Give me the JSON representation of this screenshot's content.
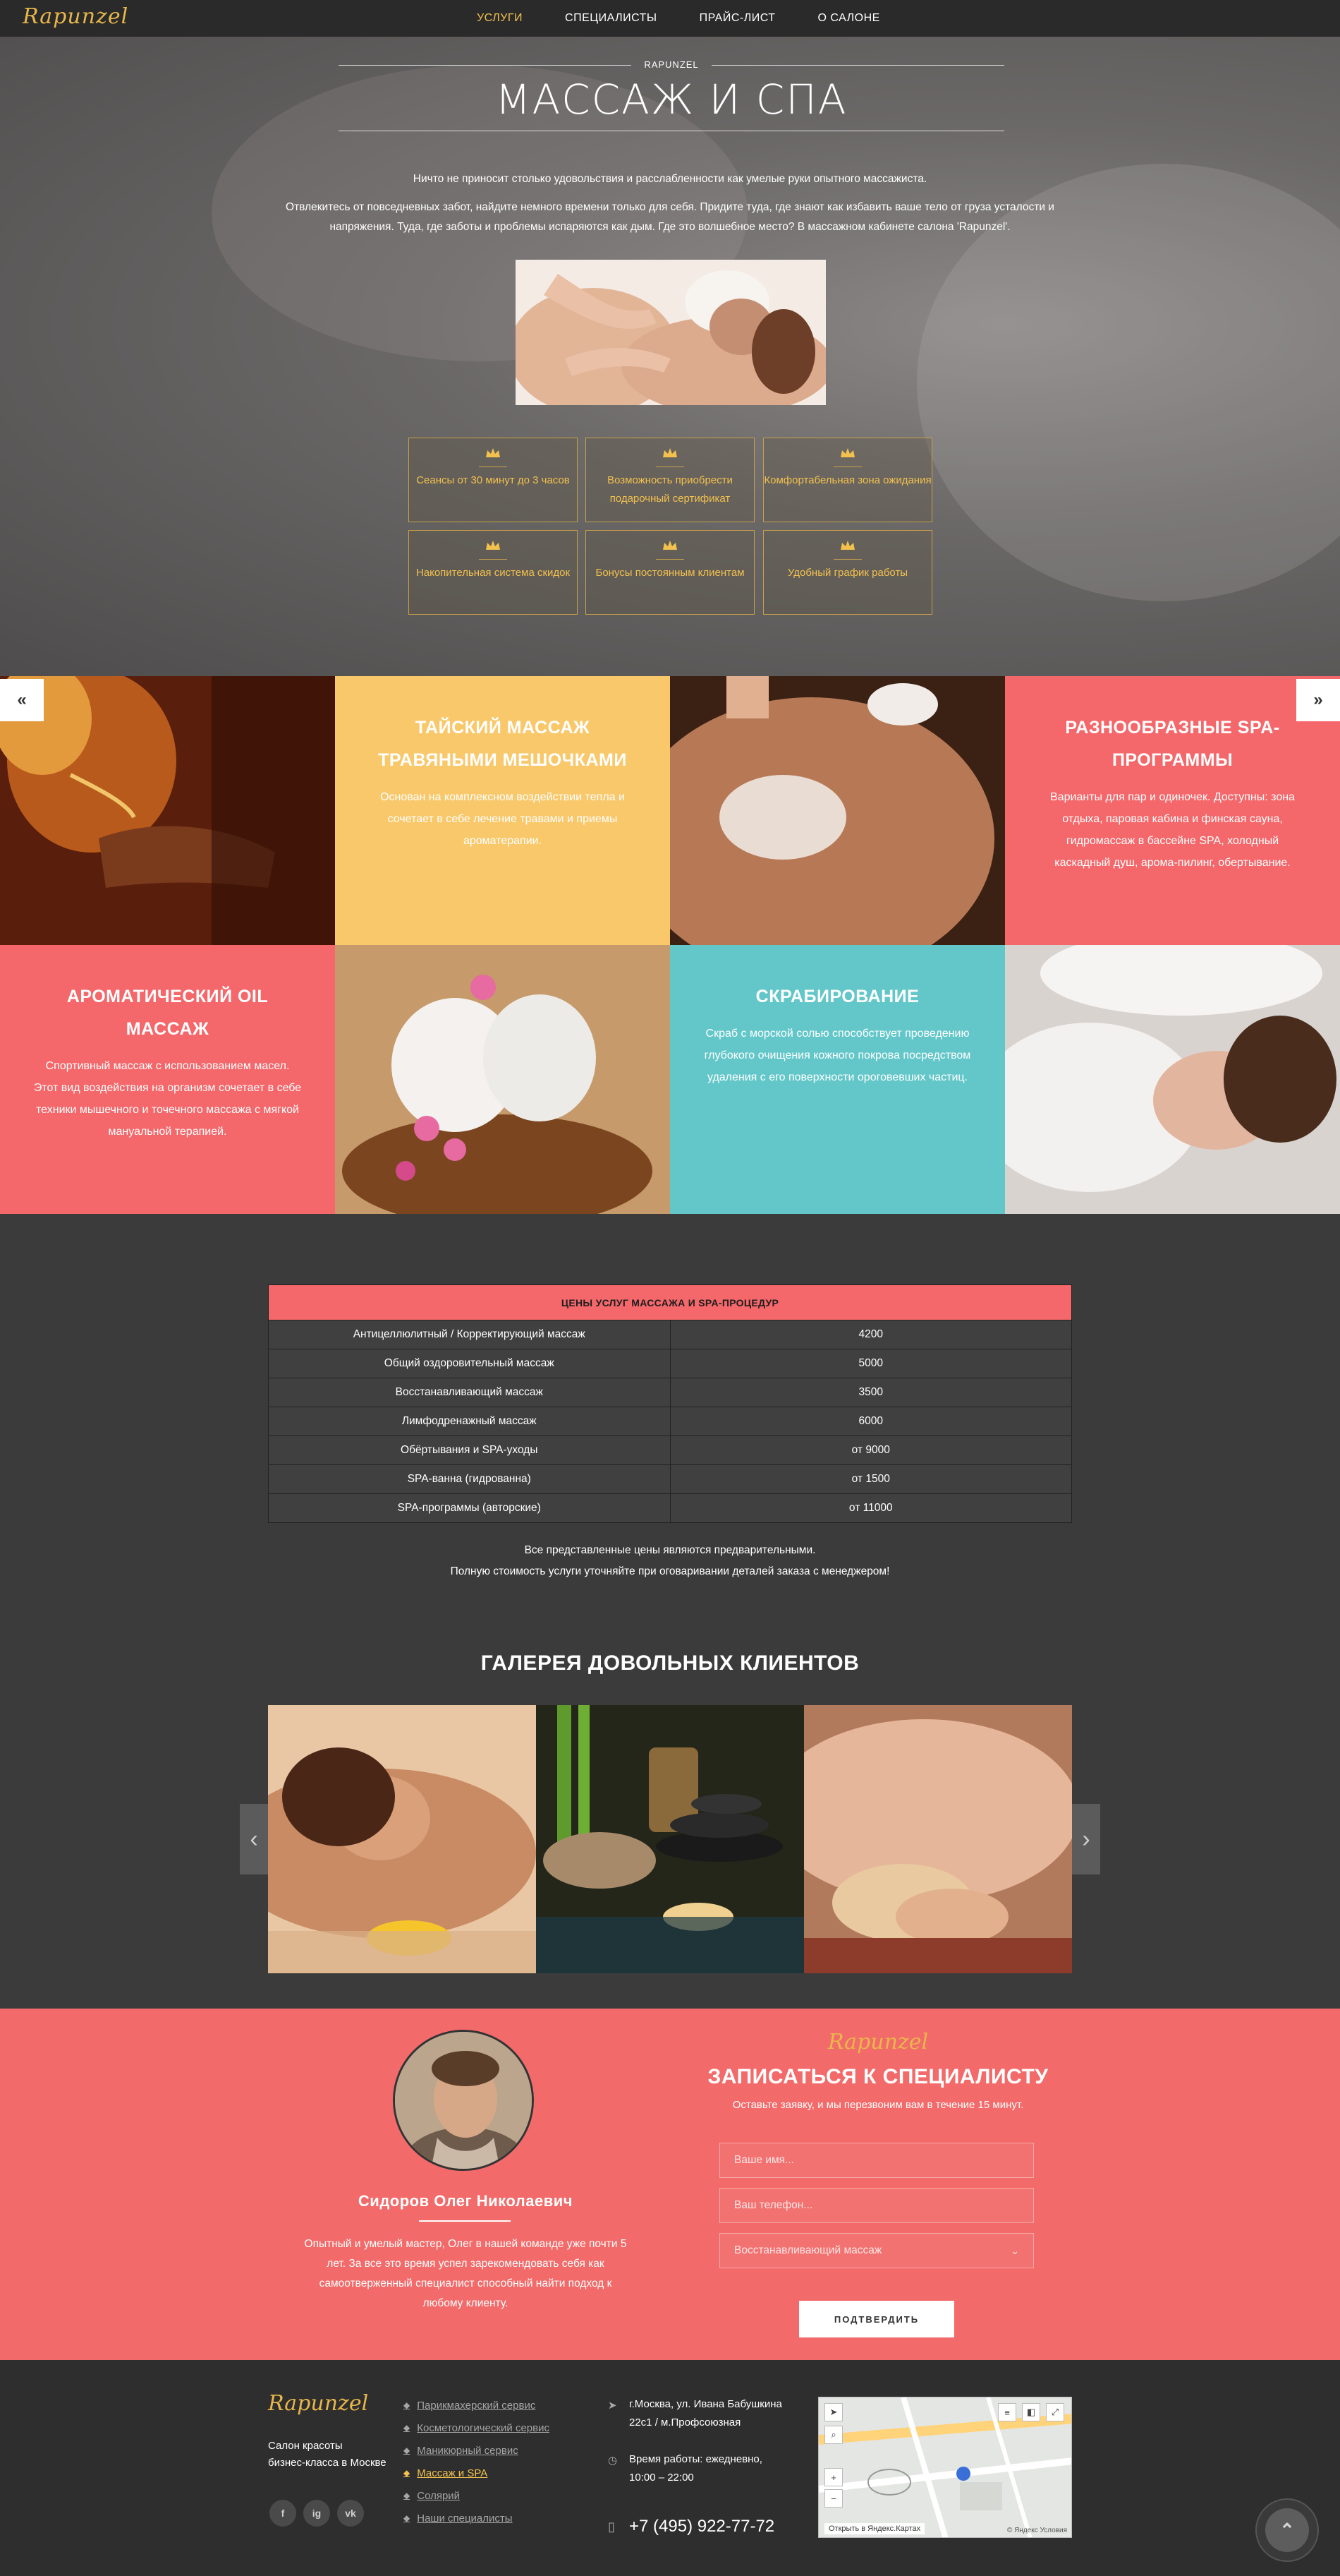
{
  "brand": {
    "logo": "Rapunzel"
  },
  "nav": {
    "items": [
      {
        "label": "УСЛУГИ"
      },
      {
        "label": "СПЕЦИАЛИСТЫ"
      },
      {
        "label": "ПРАЙС-ЛИСТ"
      },
      {
        "label": "О САЛОНЕ"
      }
    ],
    "active": "УСЛУГИ",
    "colors": {
      "active": "#f2c14e"
    }
  },
  "hero": {
    "kicker": "RAPUNZEL",
    "title": "МАССАЖ И СПА",
    "lead1": "Ничто не приносит столько удовольствия и расслабленности как умелые руки опытного массажиста.",
    "lead2": "Отвлекитесь от повседневных забот, найдите немного времени только для себя. Придите туда, где знают как избавить ваше тело от груза усталости и напряжения. Туда, где заботы и проблемы испаряются как дым. Где это волшебное место? В массажном кабинете салона 'Rapunzel'.",
    "features": [
      "Сеансы от 30 минут до 3 часов",
      "Возможность приобрести подарочный сертификат",
      "Комфортабельная зона ожидания",
      "Накопительная система скидок",
      "Бонусы постоянным клиентам",
      "Удобный график работы"
    ]
  },
  "slider": {
    "prev": "«",
    "next": "»"
  },
  "services": [
    {
      "title": "ТАЙСКИЙ МАССАЖ ТРАВЯНЫМИ МЕШОЧКАМИ",
      "text": "Основан на комплексном воздействии тепла и сочетает в себе лечение травами и приемы ароматерапии.",
      "color": "#f9c86a"
    },
    {
      "title": "РАЗНООБРАЗНЫЕ SPA-ПРОГРАММЫ",
      "text": "Варианты для пар и одиночек. Доступны: зона отдыха, паровая кабина и финская сауна, гидромассаж в бассейне SPA, холодный каскадный душ, арома-пилинг, обертывание.",
      "color": "#f4676a"
    },
    {
      "title": "АРОМАТИЧЕСКИЙ OIL МАССАЖ",
      "text": "Спортивный массаж с использованием масел. Этот вид воздействия на организм сочетает в себе техники мышечного и точечного массажа с мягкой мануальной терапией.",
      "color": "#f4676a"
    },
    {
      "title": "СКРАБИРОВАНИЕ",
      "text": "Скраб с морской солью способствует проведению глубокого очищения кожного покрова посредством удаления с его поверхности ороговевших частиц.",
      "color": "#63c7c9"
    }
  ],
  "prices": {
    "header": "ЦЕНЫ УСЛУГ МАССАЖА И SPA-ПРОЦЕДУР",
    "rows": [
      [
        "Антицеллюлитный / Корректирующий массаж",
        "4200"
      ],
      [
        "Общий оздоровительный массаж",
        "5000"
      ],
      [
        "Восстанавливающий массаж",
        "3500"
      ],
      [
        "Лимфодренажный массаж",
        "6000"
      ],
      [
        "Обёртывания и SPA-уходы",
        "от 9000"
      ],
      [
        "SPA-ванна (гидрованна)",
        "от 1500"
      ],
      [
        "SPA-программы (авторские)",
        "от 11000"
      ]
    ],
    "note1": "Все представленные цены являются предварительными.",
    "note2": "Полную стоимость услуги уточняйте при оговаривании деталей заказа с менеджером!"
  },
  "gallery": {
    "title": "ГАЛЕРЕЯ ДОВОЛЬНЫХ КЛИЕНТОВ",
    "prev": "‹",
    "next": "›"
  },
  "specialist": {
    "name": "Сидоров Олег Николаевич",
    "desc": "Опытный и умелый мастер, Олег в нашей команде уже почти 5 лет. За все это время успел зарекомендовать себя как самоотверженный специалист способный найти подход к любому клиенту."
  },
  "booking": {
    "logo": "Rapunzel",
    "title": "ЗАПИСАТЬСЯ К СПЕЦИАЛИСТУ",
    "subtitle": "Оставьте заявку, и мы перезвоним вам в течение 15 минут.",
    "name_placeholder": "Ваше имя...",
    "phone_placeholder": "Ваш телефон...",
    "service_selected": "Восстанавливающий массаж",
    "submit": "ПОДТВЕРДИТЬ"
  },
  "footer": {
    "logo": "Rapunzel",
    "desc1": "Салон красоты",
    "desc2": "бизнес-класса в Москве",
    "social": [
      "f",
      "ig",
      "vk"
    ],
    "links": [
      "Парикмахерский сервис",
      "Косметологический сервис",
      "Маникюрный сервис",
      "Массаж и SPA",
      "Солярий",
      "Наши специалисты"
    ],
    "active_link": "Массаж и SPA",
    "address1": "г.Москва, ул. Ивана Бабушкина",
    "address2": "22с1 / м.Профсоюзная",
    "hours1": "Время работы: ежедневно,",
    "hours2": "10:00 – 22:00",
    "phone": "+7 (495) 922-77-72",
    "map_caption": "Открыть в Яндекс.Картах",
    "map_copy": "© Яндекс Условия"
  }
}
